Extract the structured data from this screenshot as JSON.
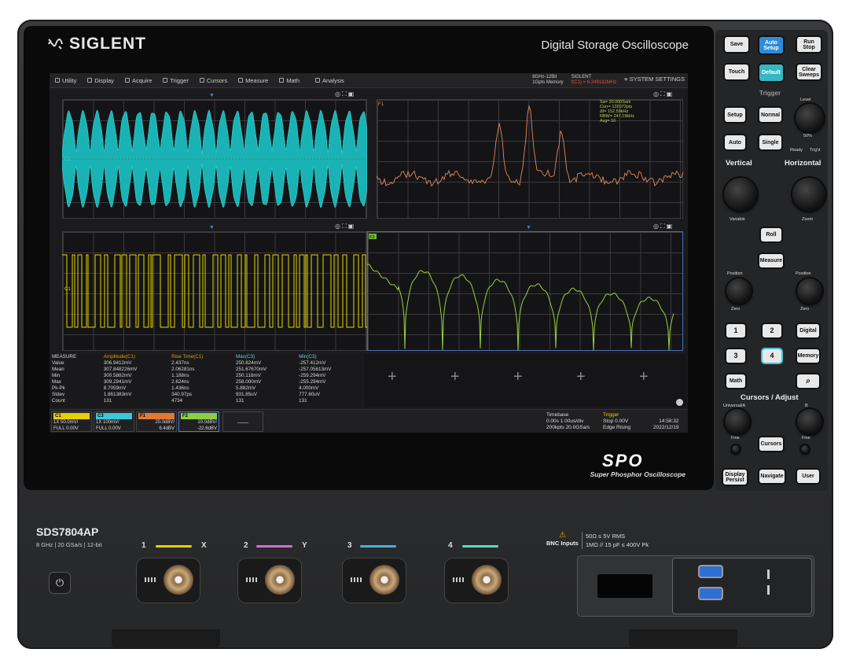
{
  "brand": {
    "name": "SIGLENT",
    "subtitle": "Digital Storage Oscilloscope"
  },
  "menu": {
    "items": [
      "Utility",
      "Display",
      "Acquire",
      "Trigger",
      "Cursors",
      "Measure",
      "Math",
      "Analysis"
    ],
    "status_1": "8GHz-12Bit",
    "status_2": "1Gpts Memory",
    "status_3": "SIGLENT",
    "status_4": "f(C1) = 6.249132MHz",
    "system_settings": "SYSTEM SETTINGS"
  },
  "waveforms": {
    "c1_label": "C1",
    "f1_label": "F1",
    "f2_label": "F2",
    "f1_info": [
      "Sa= 20.000Sa/s",
      "Curr= 132072pts",
      "Δf= 152.59kHz",
      "RBW= 247.19kHz",
      "Avg= 16"
    ]
  },
  "measure": {
    "title": "MEASURE",
    "headers": [
      "Amplitude(C1)",
      "Rise Time(C1)",
      "Max(C3)",
      "Min(C3)"
    ],
    "rows": [
      {
        "label": "Value",
        "v": [
          "306.9412mV",
          "2.437ns",
          "250.824mV",
          "-257.412mV"
        ]
      },
      {
        "label": "Mean",
        "v": [
          "307.848226mV",
          "2.06281ns",
          "251.67670mV",
          "-257.05613mV"
        ]
      },
      {
        "label": "Min",
        "v": [
          "300.5882mV",
          "1.188ns",
          "250.118mV",
          "-259.294mV"
        ]
      },
      {
        "label": "Max",
        "v": [
          "309.2941mV",
          "2.624ns",
          "258.000mV",
          "-255.294mV"
        ]
      },
      {
        "label": "Pk-Pk",
        "v": [
          "8.7059mV",
          "1.436ns",
          "5.882mV",
          "4.000mV"
        ]
      },
      {
        "label": "Stdev",
        "v": [
          "1.861383mV",
          "340.97ps",
          "931.85uV",
          "777.60uV"
        ]
      },
      {
        "label": "Count",
        "v": [
          "131",
          "4734",
          "131",
          "131"
        ]
      }
    ]
  },
  "channels": [
    {
      "hdr": "C1",
      "l1": "1X 50.0mV/",
      "l2": "FULL 0.00V",
      "color": "#e6d000"
    },
    {
      "hdr": "C3",
      "l1": "1X 100mV/",
      "l2": "FULL 0.00V",
      "color": "#3cc8d8"
    },
    {
      "hdr": "F1",
      "l1": "20.0dBV/",
      "l2": "6.4dBV",
      "color": "#e07a30"
    },
    {
      "hdr": "F2",
      "l1": "10.0dBV/",
      "l2": "-22.6dBV",
      "color": "#8cd040"
    }
  ],
  "timebase": {
    "title": "Timebase",
    "l1": "0.00s 1.00us/div",
    "l2": "200kpts 20.0GSa/s"
  },
  "trigger": {
    "title": "Trigger",
    "l1": "Stop 0.00V",
    "l2": "Edge Rising"
  },
  "clock": {
    "time": "14:58:32",
    "date": "2022/12/19"
  },
  "spo": {
    "logo": "SPO",
    "tagline": "Super Phosphor Oscilloscope"
  },
  "panel": {
    "save": "Save",
    "auto_setup": "Auto Setup",
    "run_stop": "Run Stop",
    "touch": "Touch",
    "default": "Default",
    "clear_sweeps": "Clear Sweeps",
    "trigger_title": "Trigger",
    "setup": "Setup",
    "normal": "Normal",
    "auto": "Auto",
    "single": "Single",
    "level": "Level",
    "fifty": "50%",
    "ready": "Ready",
    "trigd": "Trig'd",
    "vertical": "Vertical",
    "horizontal": "Horizontal",
    "variable": "Variable",
    "zoom": "Zoom",
    "roll": "Roll",
    "measure": "Measure",
    "position": "Position",
    "zero": "Zero",
    "k1": "1",
    "k2": "2",
    "k3": "3",
    "k4": "4",
    "digital": "Digital",
    "memory": "Memory",
    "math": "Math",
    "cursors_adjust": "Cursors / Adjust",
    "universal_a": "Universal/A",
    "b": "B",
    "fine": "Fine",
    "cursors": "Cursors",
    "display_persist": "Display Persist",
    "navigate": "Navigate",
    "user": "User"
  },
  "front": {
    "model": "SDS7804AP",
    "spec": "8 GHz | 20 GSa/s | 12-bit",
    "ch1": "1",
    "ch2": "2",
    "ch3": "3",
    "ch4": "4",
    "x": "X",
    "y": "Y",
    "bnc_title": "BNC Inputs",
    "bnc_l1": "50Ω ≤ 5V RMS",
    "bnc_l2": "1MΩ // 15 pF ≤ 400V Pk"
  }
}
